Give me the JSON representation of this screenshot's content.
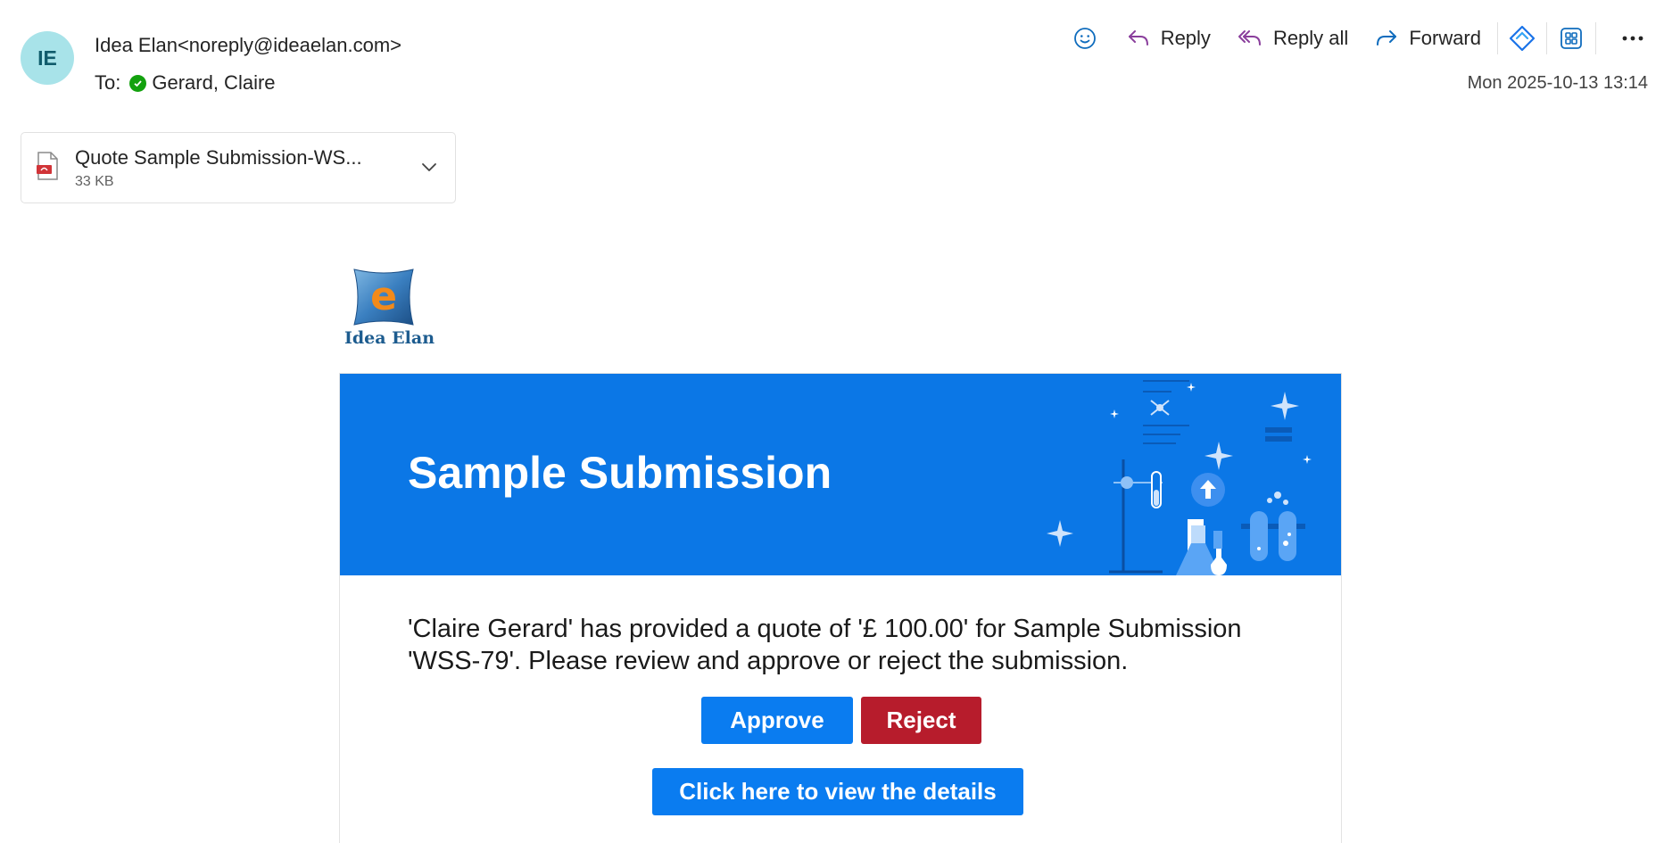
{
  "header": {
    "avatar_initials": "IE",
    "sender": "Idea Elan<noreply@ideaelan.com>",
    "to_label": "To:",
    "recipient": "Gerard, Claire",
    "datetime": "Mon 2025-10-13 13:14"
  },
  "toolbar": {
    "emoji_icon": "smiley-icon",
    "reply_label": "Reply",
    "reply_all_label": "Reply all",
    "forward_label": "Forward",
    "more_icon": "ellipsis-icon"
  },
  "attachment": {
    "name": "Quote Sample Submission-WS...",
    "size": "33 KB",
    "icon": "pdf-icon"
  },
  "email_body": {
    "logo_text": "Idea Elan",
    "banner_title": "Sample Submission",
    "message": "'Claire Gerard' has provided a quote of '£ 100.00' for Sample Submission 'WSS-79'. Please review and approve or reject the submission.",
    "approve_label": "Approve",
    "reject_label": "Reject",
    "details_label": "Click here to view the details"
  },
  "colors": {
    "banner": "#0b77e6",
    "approve": "#0a7cf0",
    "reject": "#b71c2c",
    "avatar": "#a8e3e9",
    "presence": "#13a10e"
  }
}
